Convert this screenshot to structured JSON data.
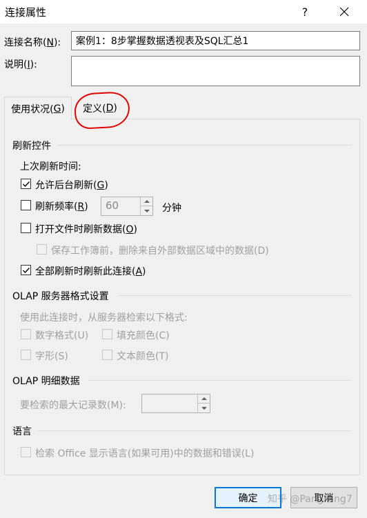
{
  "window": {
    "title": "连接属性",
    "help_label": "?"
  },
  "connection_name": {
    "label_pre": "连接名称(",
    "label_key": "N",
    "label_post": "):",
    "value": "案例1：8步掌握数据透视表及SQL汇总1"
  },
  "description": {
    "label_pre": "说明(",
    "label_key": "I",
    "label_post": "):",
    "value": ""
  },
  "tabs": [
    {
      "pre": "使用状况(",
      "key": "G",
      "post": ")"
    },
    {
      "pre": "定义(",
      "key": "D",
      "post": ")"
    }
  ],
  "refresh": {
    "section_title": "刷新控件",
    "last_refresh_label": "上次刷新时间:",
    "background": {
      "pre": "允许后台刷新(",
      "key": "G",
      "post": ")",
      "checked": true
    },
    "frequency": {
      "pre": "刷新频率(",
      "key": "R",
      "post": ")",
      "checked": false,
      "value": "60",
      "unit": "分钟"
    },
    "on_open": {
      "pre": "打开文件时刷新数据(",
      "key": "O",
      "post": ")",
      "checked": false
    },
    "remove_external": {
      "label": "保存工作簿前，删除来自外部数据区域中的数据(D)",
      "checked": false
    },
    "refresh_all": {
      "pre": "全部刷新时刷新此连接(",
      "key": "A",
      "post": ")",
      "checked": true
    }
  },
  "olap_format": {
    "section_title": "OLAP 服务器格式设置",
    "intro": "使用此连接时，从服务器检索以下格式:",
    "number_format": "数字格式(U)",
    "fill_color": "填充颜色(C)",
    "font_style": "字形(S)",
    "text_color": "文本颜色(T)"
  },
  "olap_detail": {
    "section_title": "OLAP 明细数据",
    "max_records_label": "要检索的最大记录数(M):",
    "max_records_value": ""
  },
  "language": {
    "section_title": "语言",
    "option_label": "检索 Office 显示语言(如果可用)中的数据和错误(L)"
  },
  "buttons": {
    "ok": "确定",
    "cancel": "取消"
  },
  "watermark": "知乎 @PangFang7"
}
